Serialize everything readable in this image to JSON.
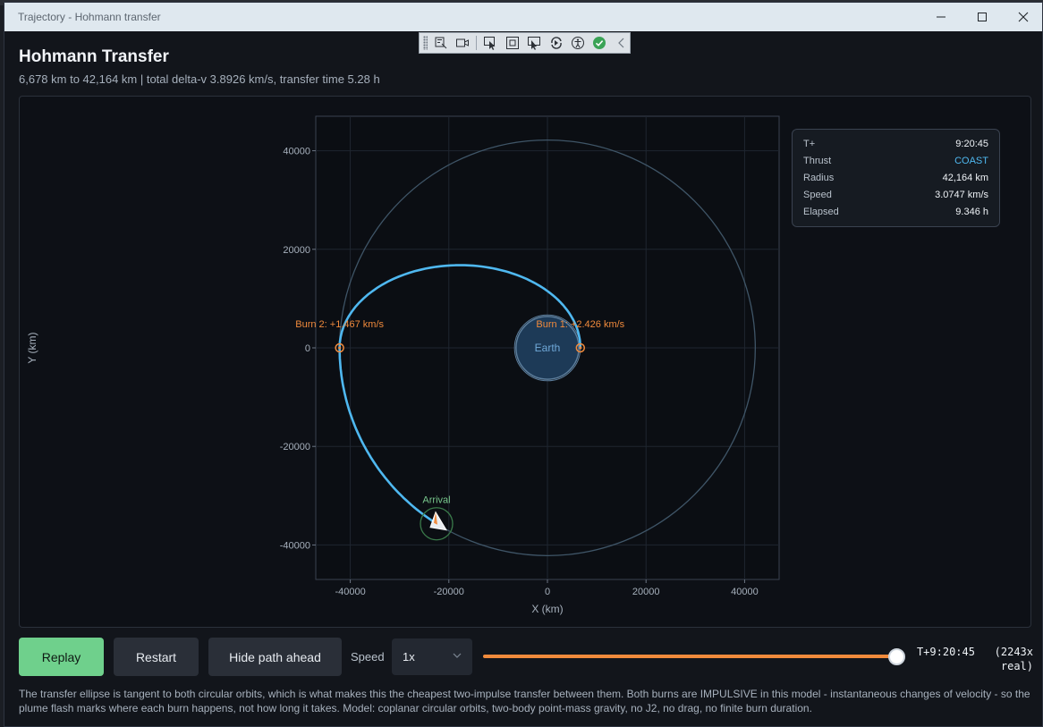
{
  "window": {
    "title": "Trajectory - Hohmann transfer"
  },
  "header": {
    "title": "Hohmann Transfer",
    "subtitle": "6,678 km to 42,164 km  |  total delta-v 3.8926 km/s, transfer time 5.28 h"
  },
  "toolbar_icons": [
    "select-element-icon",
    "record-icon",
    "pointer-icon",
    "frame-icon",
    "layout-adorner-icon",
    "hot-reload-icon",
    "accessibility-icon",
    "check-icon",
    "collapse-icon"
  ],
  "telemetry": [
    {
      "label": "T+",
      "value": "9:20:45"
    },
    {
      "label": "Thrust",
      "value": "COAST"
    },
    {
      "label": "Radius",
      "value": "42,164 km"
    },
    {
      "label": "Speed",
      "value": "3.0747 km/s"
    },
    {
      "label": "Elapsed",
      "value": "9.346 h"
    }
  ],
  "chart_data": {
    "type": "line",
    "xlabel": "X (km)",
    "ylabel": "Y (km)",
    "xlim": [
      -47000,
      47000
    ],
    "ylim": [
      -47000,
      47000
    ],
    "xticks": [
      -40000,
      -20000,
      0,
      20000,
      40000
    ],
    "yticks": [
      40000,
      20000,
      0,
      -20000,
      -40000
    ],
    "grid": true,
    "body": {
      "name": "Earth",
      "radius_km": 6371
    },
    "orbits": [
      {
        "role": "parking",
        "radius_km": 6678
      },
      {
        "role": "target",
        "radius_km": 42164
      }
    ],
    "transfer": {
      "periapsis_km": 6678,
      "apoapsis_km": 42164
    },
    "burns": [
      {
        "label": "Burn 1: +2.426 km/s",
        "x": 6678,
        "y": 0
      },
      {
        "label": "Burn 2: +1.467 km/s",
        "x": -42164,
        "y": 0
      }
    ],
    "arrival": {
      "label": "Arrival",
      "x": -22500,
      "y": -35700
    },
    "path_color": "#4fb8f0",
    "orbit_color": "#3f5567",
    "burn_color": "#f08a3c",
    "arrival_color": "#79c98e"
  },
  "controls": {
    "replay": "Replay",
    "restart": "Restart",
    "hide_path": "Hide path ahead",
    "speed_label": "Speed",
    "speed_value": "1x",
    "progress": 1.0,
    "timecode": "T+9:20:45   (2243x\nreal)"
  },
  "footnote": "The transfer ellipse is tangent to both circular orbits, which is what makes this the cheapest two-impulse transfer between them. Both burns are IMPULSIVE in this model - instantaneous changes of velocity - so the plume flash marks where each burn happens, not how long it takes. Model: coplanar circular orbits, two-body point-mass gravity, no J2, no drag, no finite burn duration."
}
